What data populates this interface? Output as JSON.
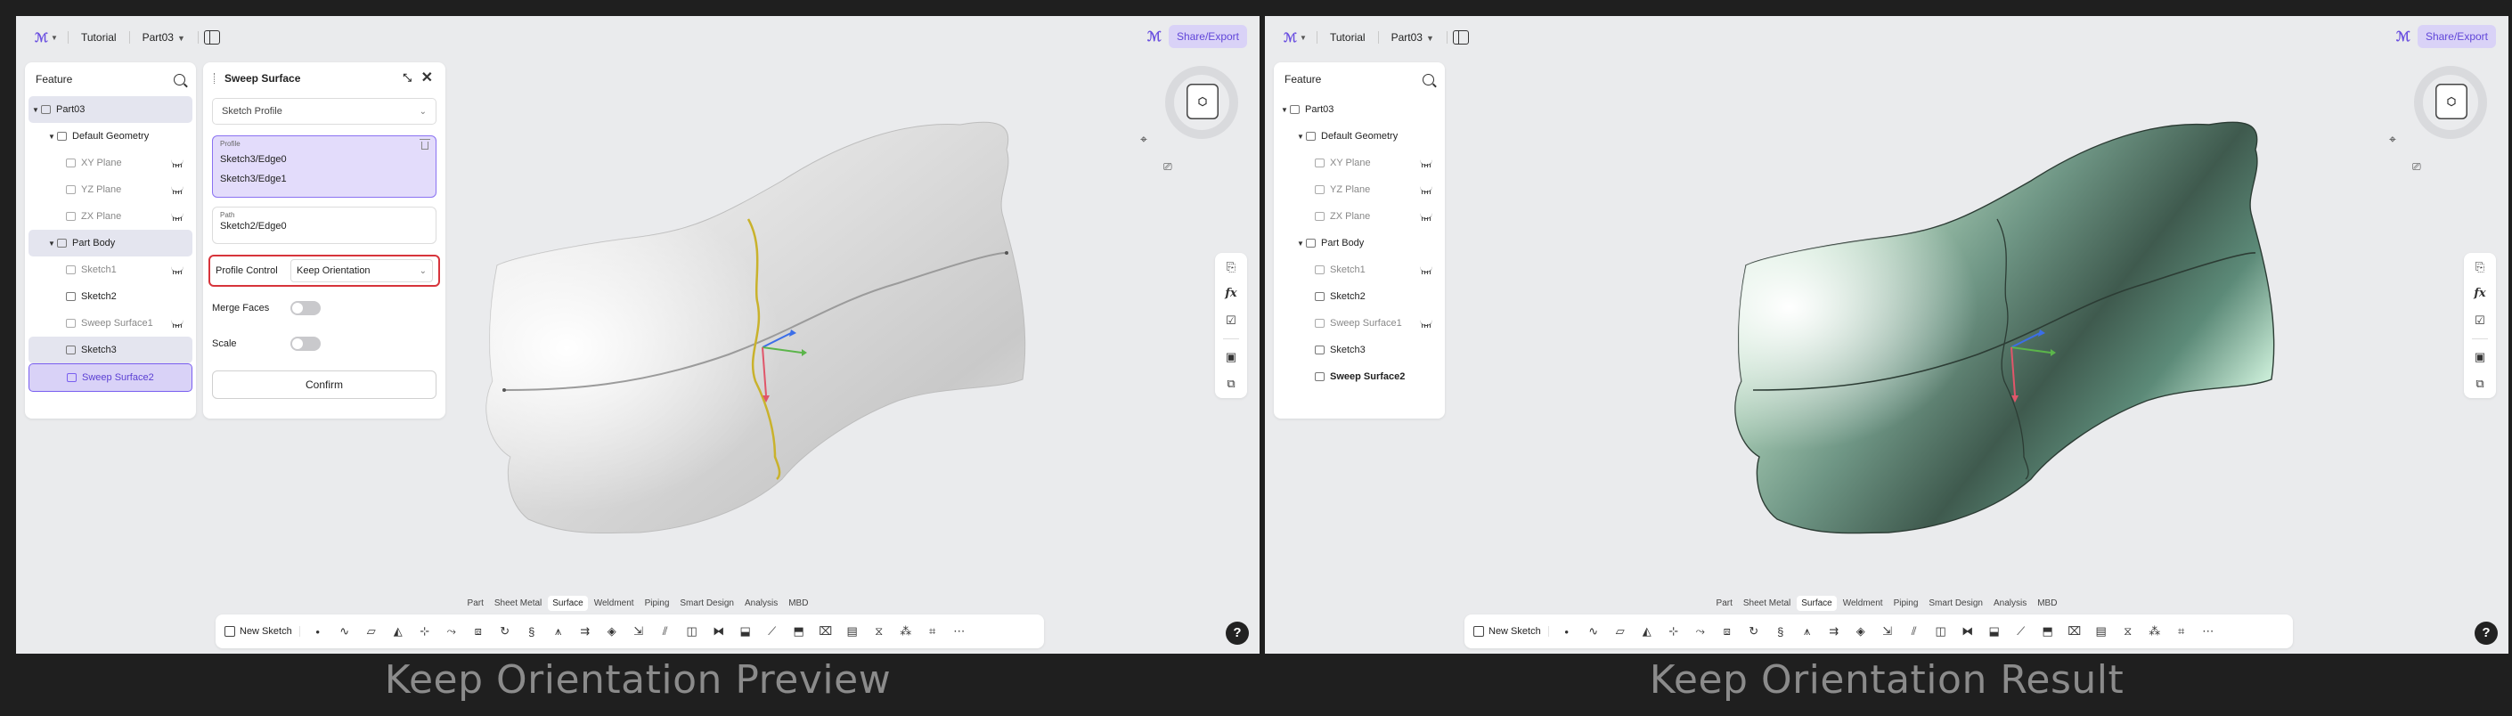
{
  "app": {
    "breadcrumb_tutorial": "Tutorial",
    "breadcrumb_part": "Part03",
    "share_label": "Share/Export",
    "accent_color": "#6a4fe0",
    "highlight_color": "#d7343b"
  },
  "feature_panel": {
    "title": "Feature",
    "search_icon": "search-icon",
    "root": "Part03",
    "default_geometry": "Default Geometry",
    "planes": [
      "XY Plane",
      "YZ Plane",
      "ZX Plane"
    ],
    "part_body": "Part Body",
    "items": [
      "Sketch1",
      "Sketch2",
      "Sweep Surface1",
      "Sketch3",
      "Sweep Surface2"
    ]
  },
  "sweep_dialog": {
    "title": "Sweep Surface",
    "profile_type": "Sketch Profile",
    "profile_label": "Profile",
    "profile_items": [
      "Sketch3/Edge0",
      "Sketch3/Edge1"
    ],
    "path_label": "Path",
    "path_value": "Sketch2/Edge0",
    "profile_control_label": "Profile Control",
    "profile_control_value": "Keep Orientation",
    "merge_faces_label": "Merge Faces",
    "merge_faces_on": false,
    "scale_label": "Scale",
    "scale_on": false,
    "confirm_label": "Confirm"
  },
  "view_cube": {
    "icons": [
      "fit-view-icon",
      "view-mode-icon"
    ]
  },
  "right_toolbar": {
    "icons": [
      "properties-icon",
      "formula-icon",
      "checklist-icon",
      "layout-icon",
      "layers-icon"
    ],
    "formula_label": "fx"
  },
  "bottom_tabs": [
    "Part",
    "Sheet Metal",
    "Surface",
    "Weldment",
    "Piping",
    "Smart Design",
    "Analysis",
    "MBD"
  ],
  "active_tab": "Surface",
  "bottom_toolbar": {
    "new_sketch_label": "New Sketch"
  },
  "help_label": "?",
  "captions": {
    "left": "Keep Orientation  Preview",
    "right": "Keep Orientation  Result"
  }
}
